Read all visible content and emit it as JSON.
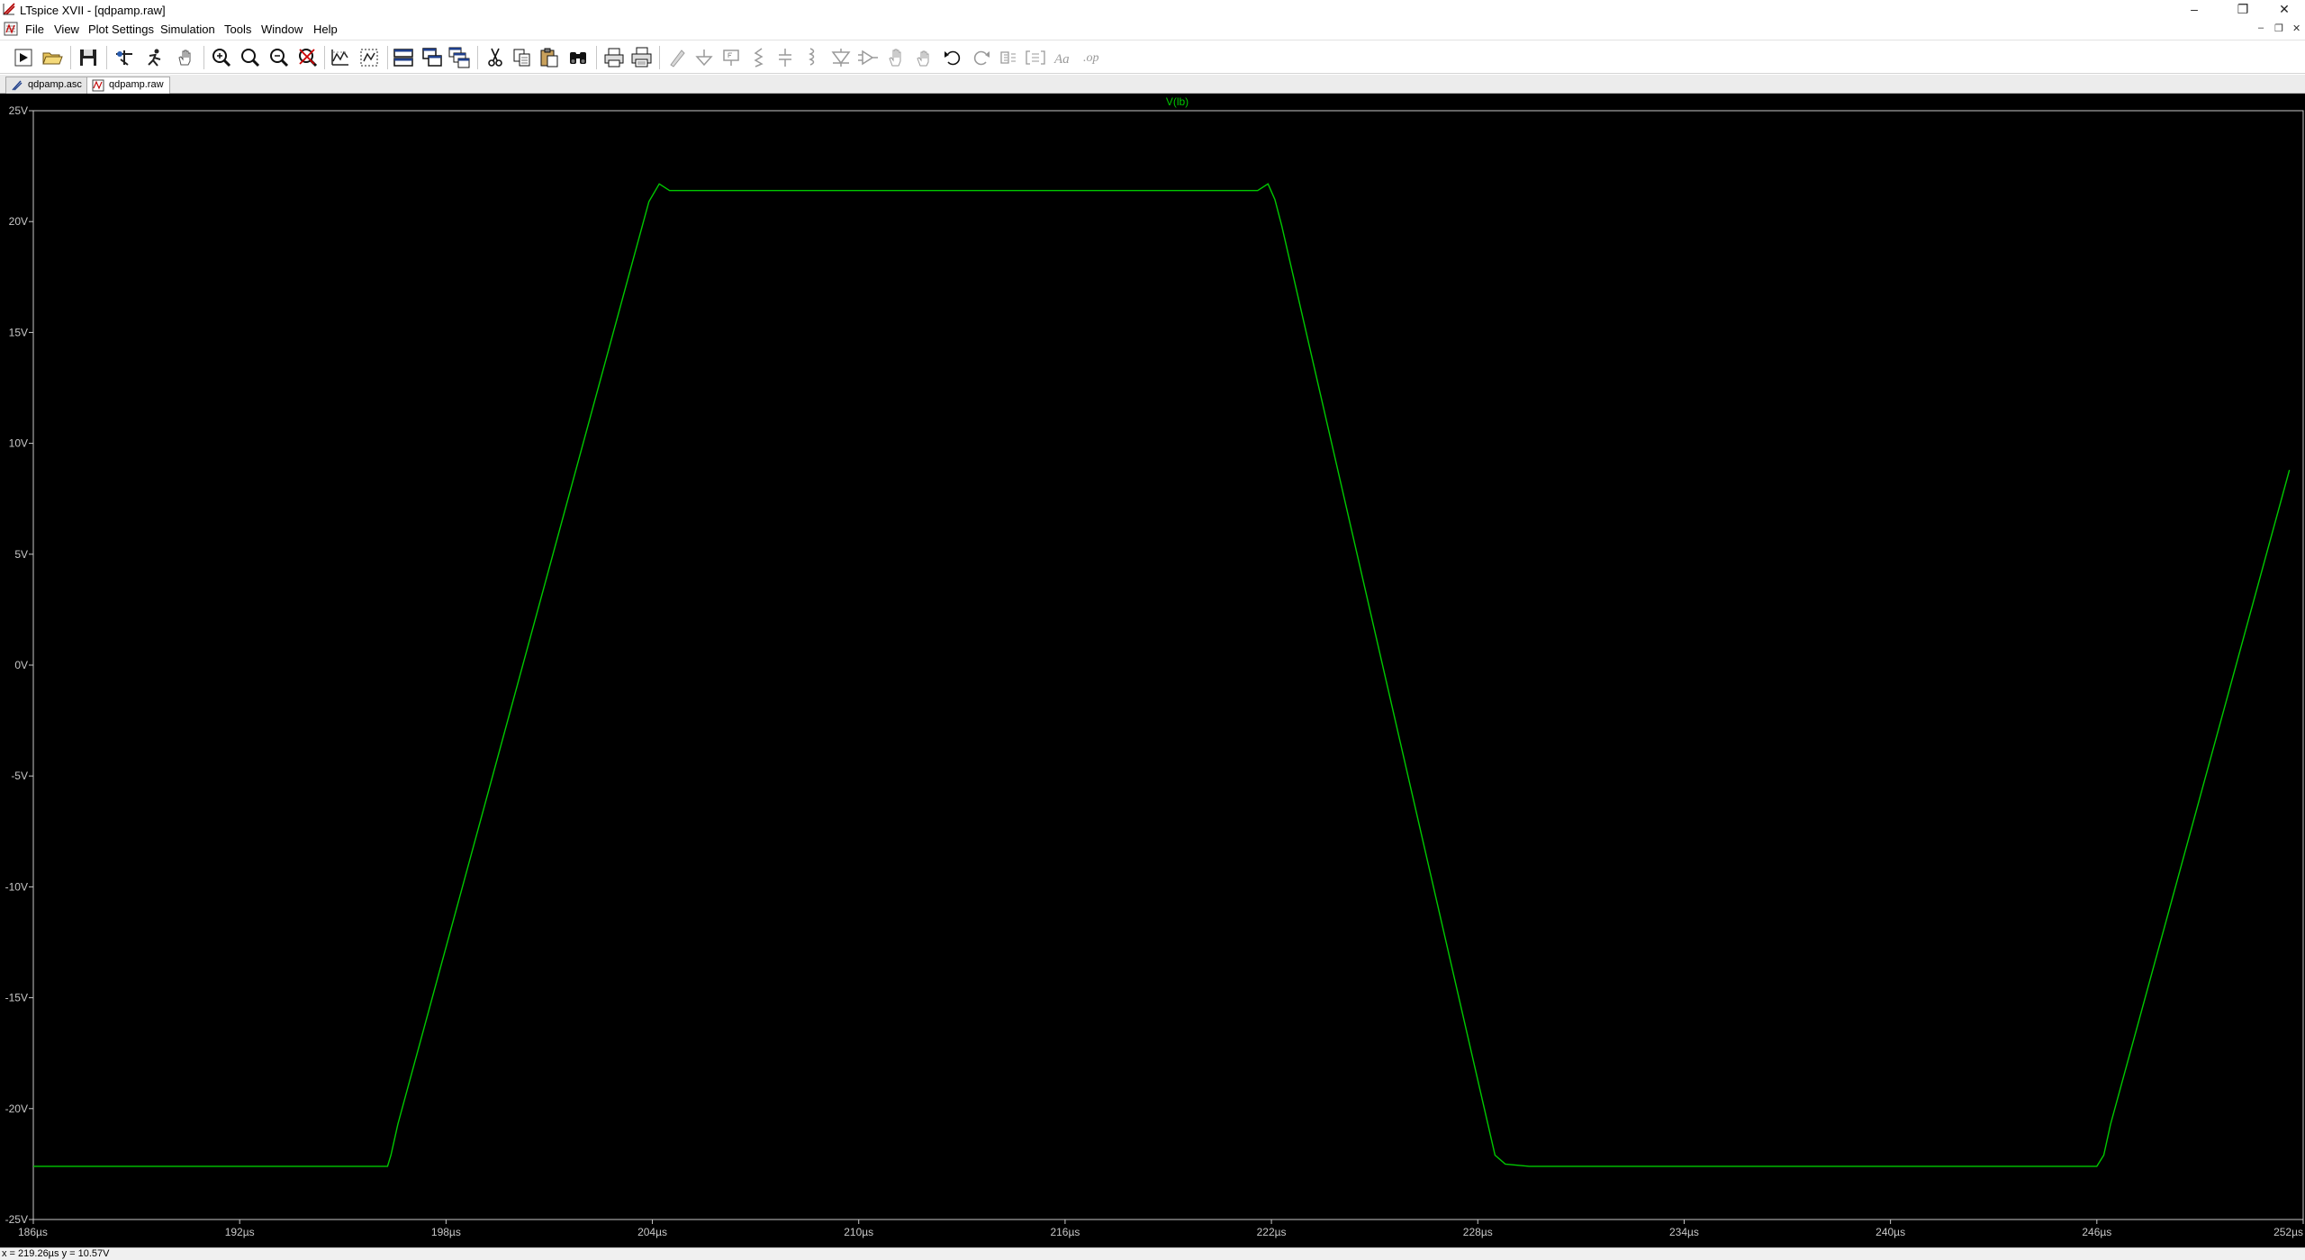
{
  "window": {
    "title": "LTspice XVII - [qdpamp.raw]",
    "controls": {
      "minimize": "–",
      "maximize": "❐",
      "close": "✕"
    }
  },
  "menu": {
    "items": [
      {
        "label": "File"
      },
      {
        "label": "View"
      },
      {
        "label": "Plot Settings"
      },
      {
        "label": "Simulation"
      },
      {
        "label": "Tools"
      },
      {
        "label": "Window"
      },
      {
        "label": "Help"
      }
    ],
    "mdi_controls": {
      "minimize": "–",
      "restore": "❐",
      "close": "✕"
    }
  },
  "toolbar": {
    "buttons": [
      {
        "name": "run-icon"
      },
      {
        "name": "open-icon"
      },
      {
        "name": "save-icon"
      },
      {
        "name": "control-panel-icon"
      },
      {
        "name": "halt-icon"
      },
      {
        "name": "pan-hand-icon"
      },
      {
        "name": "zoom-in-icon"
      },
      {
        "name": "zoom-area-icon"
      },
      {
        "name": "zoom-out-icon"
      },
      {
        "name": "zoom-fit-icon"
      },
      {
        "name": "autorange-icon"
      },
      {
        "name": "grid-icon"
      },
      {
        "name": "tile-horizontal-icon"
      },
      {
        "name": "tile-vertical-icon"
      },
      {
        "name": "cascade-icon"
      },
      {
        "name": "cut-icon"
      },
      {
        "name": "copy-icon"
      },
      {
        "name": "paste-icon"
      },
      {
        "name": "find-icon"
      },
      {
        "name": "print-icon"
      },
      {
        "name": "print-setup-icon"
      },
      {
        "name": "wire-icon"
      },
      {
        "name": "ground-icon"
      },
      {
        "name": "label-net-icon"
      },
      {
        "name": "resistor-icon"
      },
      {
        "name": "capacitor-icon"
      },
      {
        "name": "inductor-icon"
      },
      {
        "name": "diode-icon"
      },
      {
        "name": "component-icon"
      },
      {
        "name": "move-icon"
      },
      {
        "name": "drag-icon"
      },
      {
        "name": "undo-icon"
      },
      {
        "name": "redo-icon"
      },
      {
        "name": "rotate-icon"
      },
      {
        "name": "mirror-icon"
      },
      {
        "name": "text-icon"
      },
      {
        "name": "spice-directive-icon"
      }
    ],
    "text_glyphs": {
      "text": "Aa",
      "directive": ".op"
    }
  },
  "tabs": [
    {
      "label": "qdpamp.asc",
      "active": false
    },
    {
      "label": "qdpamp.raw",
      "active": true
    }
  ],
  "chart_data": {
    "type": "line",
    "trace_label": "V(lb)",
    "trace_color": "#00c800",
    "background": "#000000",
    "xlim": [
      186,
      252
    ],
    "ylim": [
      -25,
      25
    ],
    "x_ticks": [
      "186µs",
      "192µs",
      "198µs",
      "204µs",
      "210µs",
      "216µs",
      "222µs",
      "228µs",
      "234µs",
      "240µs",
      "246µs",
      "252µs"
    ],
    "y_ticks": [
      "25V",
      "20V",
      "15V",
      "10V",
      "5V",
      "0V",
      "-5V",
      "-10V",
      "-15V",
      "-20V",
      "-25V"
    ],
    "series": [
      {
        "name": "V(lb)",
        "x": [
          186,
          196.3,
          196.4,
          196.6,
          203.9,
          204.2,
          204.5,
          205,
          221.6,
          221.9,
          222.1,
          222.3,
          228.5,
          228.8,
          229.5,
          246,
          246.2,
          246.4,
          251.6
        ],
        "y": [
          -22.6,
          -22.6,
          -22.1,
          -20.7,
          20.9,
          21.7,
          21.4,
          21.4,
          21.4,
          21.7,
          21.0,
          19.8,
          -22.1,
          -22.5,
          -22.6,
          -22.6,
          -22.1,
          -20.7,
          8.8
        ]
      }
    ],
    "grid": false
  },
  "status": {
    "cursor": "x = 219.26µs    y = 10.57V"
  }
}
